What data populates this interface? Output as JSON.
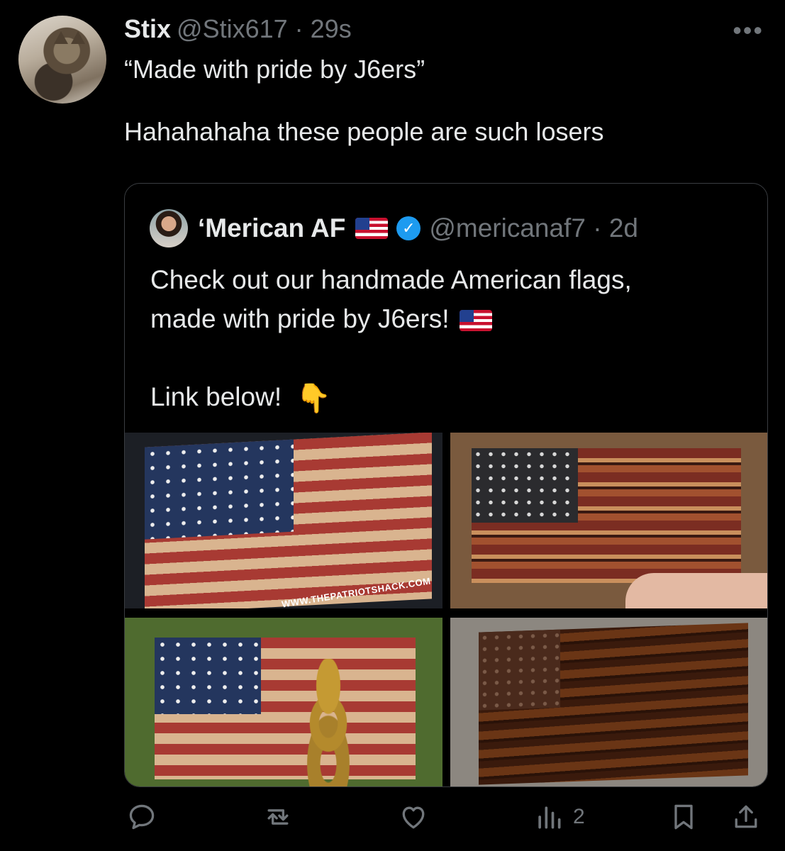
{
  "tweet": {
    "display_name": "Stix",
    "handle_time": "@Stix617 · 29s",
    "more_icon": "•••",
    "lines": [
      "“Made with pride by J6ers”",
      "Hahahahaha these people are such losers"
    ]
  },
  "quoted_tweet": {
    "display_name": "‘Merican AF",
    "verified": "✓",
    "handle_time": "@mericanaf7 · 2d",
    "line1": "Check out our handmade American flags,",
    "line2": "made with pride by J6ers!",
    "line3": "Link below!",
    "point_emoji": "👇",
    "images": [
      {
        "watermark": "WWW.THEPATRIOTSHACK.COM"
      }
    ]
  },
  "actions": {
    "reply": "reply-icon",
    "retweet": "retweet-icon",
    "like": "heart-icon",
    "views_count": "2",
    "bookmark": "bookmark-icon",
    "share": "share-icon"
  },
  "colors": {
    "background": "#000000",
    "text": "#e7e9ea",
    "muted": "#71767b",
    "verified": "#1d9bf0",
    "border": "#3a3d41"
  }
}
